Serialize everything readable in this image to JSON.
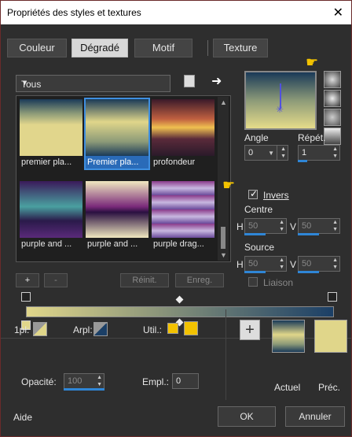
{
  "window": {
    "title": "Propriétés des styles et textures",
    "close": "✕"
  },
  "tabs": [
    {
      "label": "Couleur"
    },
    {
      "label": "Dégradé"
    },
    {
      "label": "Motif"
    },
    {
      "label": "Texture"
    }
  ],
  "category": {
    "selected": "Tous"
  },
  "gallery": [
    {
      "label": "premier pla...",
      "colors": [
        "#e1d68c",
        "#e1d68c"
      ]
    },
    {
      "label": "Premier pla...",
      "colors": [
        "#1a3a58",
        "#e0d68a"
      ]
    },
    {
      "label": "profondeur",
      "colors": [
        "#5a2a2a",
        "#e0a040"
      ]
    },
    {
      "label": "purple and ...",
      "colors": [
        "#3a1a5a",
        "#4aa0a0"
      ]
    },
    {
      "label": "purple and ...",
      "colors": [
        "#3a1050",
        "#f0e8c0"
      ]
    },
    {
      "label": "purple drag...",
      "colors": [
        "#8a3a8a",
        "#c8b8e0"
      ]
    }
  ],
  "actions": {
    "add": "+",
    "remove": "-",
    "reset": "Réinit.",
    "save": "Enreg."
  },
  "angle": {
    "label": "Angle",
    "value": "0"
  },
  "repeat": {
    "label": "Répét.",
    "value": "1"
  },
  "invert": {
    "label": "Invers",
    "checked": true
  },
  "center": {
    "label": "Centre",
    "h_label": "H",
    "v_label": "V",
    "h": "50",
    "v": "50"
  },
  "source": {
    "label": "Source",
    "h_label": "H",
    "v_label": "V",
    "h": "50",
    "v": "50"
  },
  "link": {
    "label": "Liaison"
  },
  "stops": {
    "fg_label": "1pl:",
    "fg_color": "#e0d68a",
    "bg_label": "Arpl:",
    "bg_color": "#1b3f66",
    "user_label": "Util.:",
    "user_color": "#f2c200",
    "opacity_label": "Opacité:",
    "opacity": "100",
    "location_label": "Empl.:",
    "location": "0"
  },
  "swatches": {
    "current_label": "Actuel",
    "previous_label": "Préc."
  },
  "footer": {
    "help": "Aide",
    "ok": "OK",
    "cancel": "Annuler"
  },
  "colors": {
    "accent": "#3f8fe0",
    "grad_start": "#e0d68a",
    "grad_end": "#1b3f66"
  }
}
